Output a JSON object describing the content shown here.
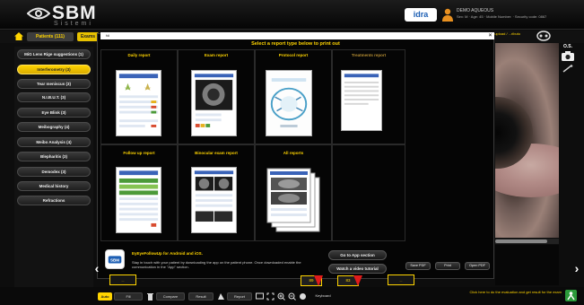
{
  "header": {
    "logo_word": "SBM",
    "logo_sub": "Sistemi",
    "partner": "idra",
    "user_name": "DEMO AQUEOUS",
    "user_info": "Sex: M · Age: 45 · Mobile Number: · Security code: 0867"
  },
  "tabs": {
    "patients": "Patients (111)",
    "second": "Exams",
    "right": "...upload / ...ributo"
  },
  "eye_side": "O.S.",
  "sidebar": {
    "items": [
      "MiG Lens Rige suggestions (1)",
      "Interferometry (3)",
      "Tear meniscus (3)",
      "N.I.B.U.T. (3)",
      "Eye Blink (3)",
      "Meibography (4)",
      "Meibo Analysis (4)",
      "Blepharitis (3)",
      "Demodex (3)",
      "Medical history",
      "Refractions"
    ],
    "active_index": 1
  },
  "modal": {
    "search_value": "fdi",
    "title": "Select a report type below to print out",
    "reports": [
      "Daily report",
      "Exam report",
      "Protocol report",
      "Treatments report",
      "Follow up report",
      "Binocular exam report",
      "All reports"
    ],
    "app": {
      "title": "EyEyeFollowUp for Android and iOS.",
      "text": "Stay in touch with your patient by downloading the app on the patient phone. Once downloaded enable the communication in the \"App\" section."
    },
    "btn_app_section": "Go to App section",
    "btn_video": "Watch a video tutorial",
    "btn_save_pdf": "Save PDF",
    "btn_print": "Print",
    "btn_open_pdf": "Open PDF"
  },
  "bottom": {
    "mode": "Auto",
    "fill": "Fill",
    "compare": "Compare",
    "result": "Result",
    "report": "Report",
    "keyboard": "Keyboard",
    "num_left": "89",
    "num_right": "83",
    "thumb_left": "...",
    "thumb_right": "...",
    "eval_text": "Click here to do the evaluation and get result for the exam"
  }
}
